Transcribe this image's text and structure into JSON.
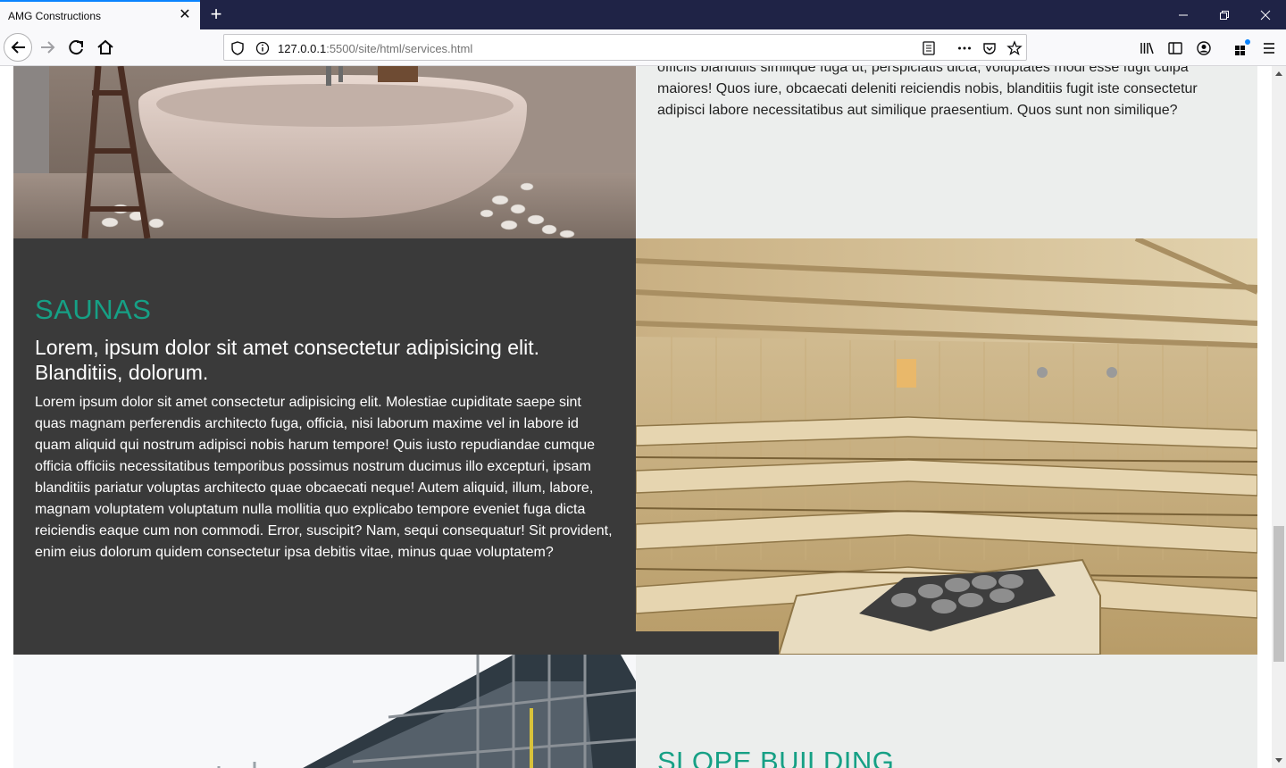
{
  "browser": {
    "tab_title": "AMG Constructions",
    "url_host": "127.0.0.1",
    "url_rest": ":5500/site/html/services.html"
  },
  "services": {
    "top_paragraph": "officiis blanditiis similique fuga ut, perspiciatis dicta, voluptates modi esse fugit culpa maiores! Quos iure, obcaecati deleniti reiciendis nobis, blanditiis fugit iste consectetur adipisci labore necessitatibus aut similique praesentium. Quos sunt non similique?",
    "saunas": {
      "title": "SAUNAS",
      "subtitle": "Lorem, ipsum dolor sit amet consectetur adipisicing elit. Blanditiis, dolorum.",
      "body": "Lorem ipsum dolor sit amet consectetur adipisicing elit. Molestiae cupiditate saepe sint quas magnam perferendis architecto fuga, officia, nisi laborum maxime vel in labore id quam aliquid qui nostrum adipisci nobis harum tempore! Quis iusto repudiandae cumque officia officiis necessitatibus temporibus possimus nostrum ducimus illo excepturi, ipsam blanditiis pariatur voluptas architecto quae obcaecati neque! Autem aliquid, illum, labore, magnam voluptatem voluptatum nulla mollitia quo explicabo tempore eveniet fuga dicta reiciendis eaque cum non commodi. Error, suscipit? Nam, sequi consequatur! Sit provident, enim eius dolorum quidem consectetur ipsa debitis vitae, minus quae voluptatem?"
    },
    "slope_building": {
      "title": "SLOPE BUILDING"
    }
  },
  "colors": {
    "accent": "#16a085",
    "dark_panel": "#3a3a3a",
    "light_panel": "#eceeed"
  }
}
